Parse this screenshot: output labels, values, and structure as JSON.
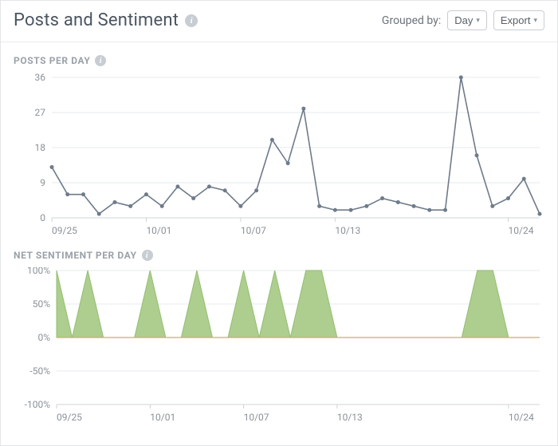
{
  "header": {
    "title": "Posts and Sentiment",
    "grouped_label": "Grouped by:",
    "grouping_value": "Day",
    "export_label": "Export"
  },
  "sections": {
    "posts": {
      "title": "POSTS PER DAY"
    },
    "sentiment": {
      "title": "NET SENTIMENT PER DAY"
    }
  },
  "chart_data": [
    {
      "type": "line",
      "title": "Posts per Day",
      "xlabel": "",
      "ylabel": "",
      "ylim": [
        0,
        36
      ],
      "y_ticks": [
        0,
        9,
        18,
        27,
        36
      ],
      "x_ticks": [
        "09/25",
        "10/01",
        "10/07",
        "10/13",
        "10/24"
      ],
      "x_tick_positions": [
        0,
        6,
        12,
        18,
        29
      ],
      "categories": [
        "09/25",
        "09/26",
        "09/27",
        "09/28",
        "09/29",
        "09/30",
        "10/01",
        "10/02",
        "10/03",
        "10/04",
        "10/05",
        "10/06",
        "10/07",
        "10/08",
        "10/09",
        "10/10",
        "10/11",
        "10/12",
        "10/13",
        "10/14",
        "10/15",
        "10/16",
        "10/17",
        "10/18",
        "10/19",
        "10/20",
        "10/21",
        "10/22",
        "10/23",
        "10/24",
        "10/25",
        "10/26"
      ],
      "series": [
        {
          "name": "Posts",
          "values": [
            13,
            6,
            6,
            1,
            4,
            3,
            6,
            3,
            8,
            5,
            8,
            7,
            3,
            7,
            20,
            14,
            28,
            3,
            2,
            2,
            3,
            5,
            4,
            3,
            2,
            2,
            36,
            16,
            3,
            5,
            10,
            1
          ]
        }
      ]
    },
    {
      "type": "area",
      "title": "Net Sentiment per Day",
      "xlabel": "",
      "ylabel": "",
      "ylim": [
        -100,
        100
      ],
      "y_ticks": [
        -100,
        -50,
        0,
        50,
        100
      ],
      "y_tick_labels": [
        "-100%",
        "-50%",
        "0%",
        "50%",
        "100%"
      ],
      "x_ticks": [
        "09/25",
        "10/01",
        "10/07",
        "10/13",
        "10/24"
      ],
      "x_tick_positions": [
        0,
        6,
        12,
        18,
        29
      ],
      "categories": [
        "09/25",
        "09/26",
        "09/27",
        "09/28",
        "09/29",
        "09/30",
        "10/01",
        "10/02",
        "10/03",
        "10/04",
        "10/05",
        "10/06",
        "10/07",
        "10/08",
        "10/09",
        "10/10",
        "10/11",
        "10/12",
        "10/13",
        "10/14",
        "10/15",
        "10/16",
        "10/17",
        "10/18",
        "10/19",
        "10/20",
        "10/21",
        "10/22",
        "10/23",
        "10/24",
        "10/25",
        "10/26"
      ],
      "series": [
        {
          "name": "Net Sentiment %",
          "values": [
            100,
            0,
            100,
            0,
            0,
            0,
            100,
            0,
            0,
            100,
            0,
            0,
            100,
            0,
            100,
            0,
            100,
            100,
            0,
            0,
            0,
            0,
            0,
            0,
            0,
            0,
            0,
            100,
            100,
            0,
            0,
            0
          ]
        }
      ]
    }
  ]
}
